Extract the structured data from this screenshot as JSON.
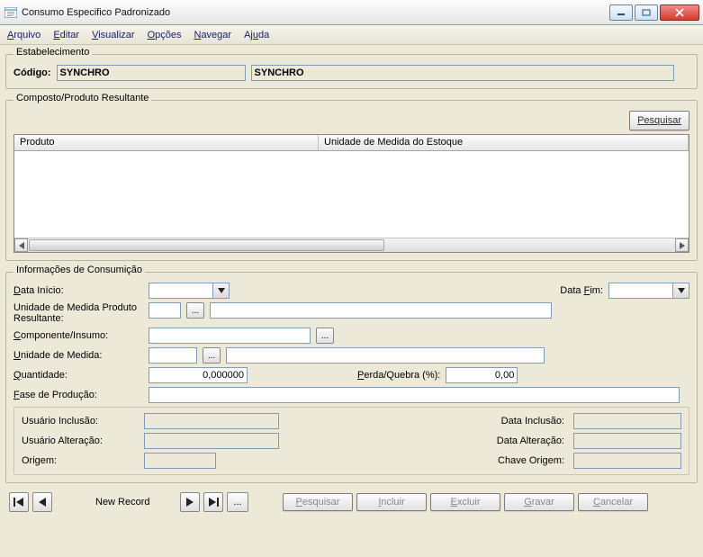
{
  "window": {
    "title": "Consumo Especifico Padronizado"
  },
  "menu": {
    "arquivo": "Arquivo",
    "editar": "Editar",
    "visualizar": "Visualizar",
    "opcoes": "Opções",
    "navegar": "Navegar",
    "ajuda": "Ajuda"
  },
  "estab": {
    "legend": "Estabelecimento",
    "codigo_label": "Código:",
    "codigo_value": "SYNCHRO",
    "nome_value": "SYNCHRO"
  },
  "composto": {
    "legend": "Composto/Produto Resultante",
    "pesquisar_btn": "Pesquisar",
    "col_produto": "Produto",
    "col_unidade": "Unidade de Medida do Estoque"
  },
  "info": {
    "legend": "Informações de Consumição",
    "data_inicio": "Data Início:",
    "data_fim": "Data Fim:",
    "um_prod": "Unidade de Medida Produto Resultante:",
    "componente": "Componente/Insumo:",
    "um": "Unidade de Medida:",
    "quantidade": "Quantidade:",
    "quantidade_value": "0,000000",
    "perda": "Perda/Quebra (%):",
    "perda_value": "0,00",
    "fase": "Fase de Produção:",
    "usuario_inclusao": "Usuário Inclusão:",
    "data_inclusao": "Data Inclusão:",
    "usuario_alteracao": "Usuário Alteração:",
    "data_alteracao": "Data Alteração:",
    "origem": "Origem:",
    "chave_origem": "Chave Origem:"
  },
  "footer": {
    "status": "New Record",
    "pesquisar": "Pesquisar",
    "incluir": "Incluir",
    "excluir": "Excluir",
    "gravar": "Gravar",
    "cancelar": "Cancelar"
  }
}
